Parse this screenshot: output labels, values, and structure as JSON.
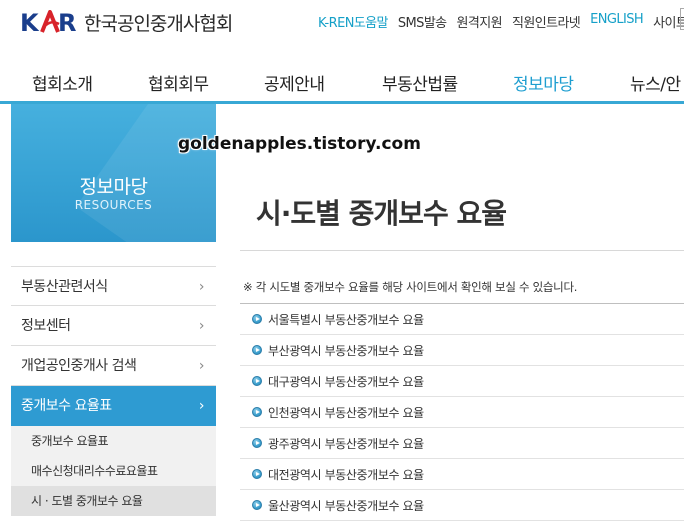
{
  "header": {
    "logo_text": "한국공인중개사협회",
    "logo_letters": [
      "K",
      "R"
    ],
    "util_links": [
      {
        "label": "K-REN도움말",
        "highlight": true
      },
      {
        "label": "SMS발송",
        "highlight": false
      },
      {
        "label": "원격지원",
        "highlight": false
      },
      {
        "label": "직원인트라넷",
        "highlight": false
      },
      {
        "label": "ENGLISH",
        "highlight": true
      },
      {
        "label": "사이트맵",
        "highlight": false
      }
    ]
  },
  "gnb": {
    "items": [
      {
        "label": "협회소개"
      },
      {
        "label": "협회회무"
      },
      {
        "label": "공제안내"
      },
      {
        "label": "부동산법률"
      },
      {
        "label": "정보마당",
        "active": true
      },
      {
        "label": "뉴스/안"
      }
    ]
  },
  "lnb": {
    "title": "정보마당",
    "subtitle": "RESOURCES",
    "items": [
      {
        "label": "부동산관련서식"
      },
      {
        "label": "정보센터"
      },
      {
        "label": "개업공인중개사 검색"
      },
      {
        "label": "중개보수 요율표",
        "active": true
      }
    ],
    "subitems": [
      {
        "label": "중개보수 요율표"
      },
      {
        "label": "매수신청대리수수료요율표"
      },
      {
        "label": "시 · 도별 중개보수 요율",
        "current": true
      }
    ]
  },
  "content": {
    "watermark": "goldenapples.tistory.com",
    "page_title": "시·도별 중개보수 요율",
    "notice": "※ 각 시도별 중개보수 요율를 해당 사이트에서 확인해 보실 수 있습니다.",
    "links": [
      {
        "label": "서울특별시 부동산중개보수 요율"
      },
      {
        "label": "부산광역시 부동산중개보수 요율"
      },
      {
        "label": "대구광역시 부동산중개보수 요율"
      },
      {
        "label": "인천광역시 부동산중개보수 요율"
      },
      {
        "label": "광주광역시 부동산중개보수 요율"
      },
      {
        "label": "대전광역시 부동산중개보수 요율"
      },
      {
        "label": "울산광역시 부동산중개보수 요율"
      }
    ]
  },
  "colors": {
    "accent": "#38a8d5",
    "brand_blue": "#1a3e8c",
    "brand_red": "#d8232a"
  }
}
